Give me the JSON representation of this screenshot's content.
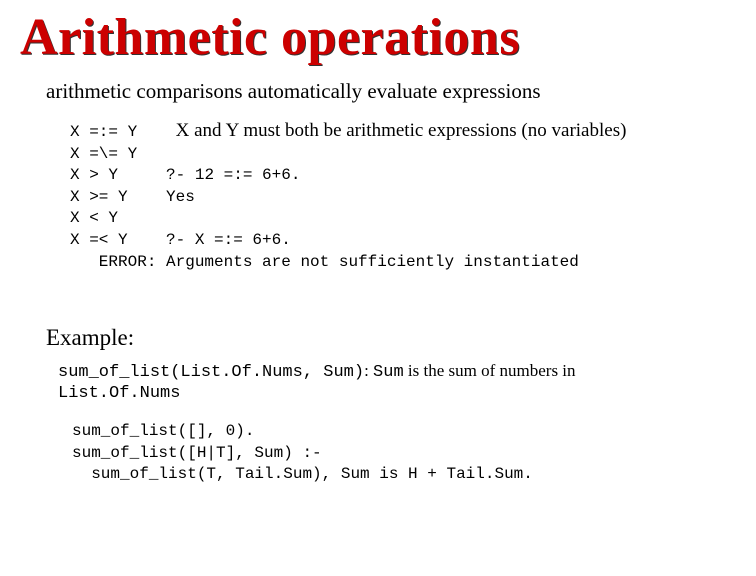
{
  "title": "Arithmetic operations",
  "subtitle": "arithmetic comparisons automatically evaluate expressions",
  "codeLines": {
    "line1_code": "X =:= Y",
    "line1_note": "X and Y must both be arithmetic expressions (no variables)",
    "line2": "X =\\= Y",
    "line3_code": "X > Y",
    "line3_output": "?- 12 =:= 6+6.",
    "line4_code": "X >= Y",
    "line4_output": "Yes",
    "line5": "X < Y",
    "line6_code": "X =< Y",
    "line6_output": "?- X =:= 6+6.",
    "line7": "   ERROR: Arguments are not sufficiently instantiated"
  },
  "exampleHeading": "Example:",
  "exampleDesc": {
    "code1": "sum_of_list(List.Of.Nums, Sum)",
    "text1": ": ",
    "code2": "Sum",
    "text2": " is the sum of numbers in ",
    "code3": "List.Of.Nums"
  },
  "exampleCode": {
    "line1": "sum_of_list([], 0).",
    "line2": "sum_of_list([H|T], Sum) :-",
    "line3": "  sum_of_list(T, Tail.Sum), Sum is H + Tail.Sum."
  }
}
